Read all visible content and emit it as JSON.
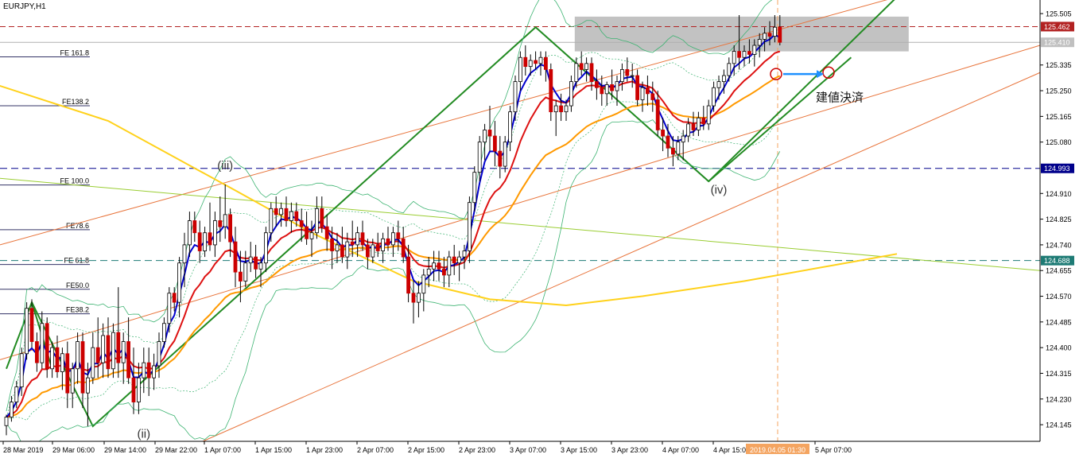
{
  "chart_data": {
    "type": "candlestick",
    "symbol_label": "EURJPY,H1",
    "price_axis": {
      "ticks": [
        "125.505",
        "125.335",
        "125.250",
        "125.165",
        "125.080",
        "124.910",
        "124.825",
        "124.740",
        "124.655",
        "124.570",
        "124.485",
        "124.400",
        "124.315",
        "124.230",
        "124.145"
      ],
      "range": [
        124.09,
        125.55
      ],
      "current_bid": "125.410",
      "markers": [
        {
          "label": "125.462",
          "value": 125.462,
          "color": "#b22222"
        },
        {
          "label": "124.993",
          "value": 124.993,
          "color": "#00008b"
        },
        {
          "label": "124.688",
          "value": 124.688,
          "color": "#1e7b75"
        }
      ]
    },
    "time_axis": {
      "labels": [
        "28 Mar 2019",
        "29 Mar 06:00",
        "29 Mar 14:00",
        "29 Mar 22:00",
        "1 Apr 07:00",
        "1 Apr 15:00",
        "1 Apr 23:00",
        "2 Apr 07:00",
        "2 Apr 15:00",
        "2 Apr 23:00",
        "3 Apr 07:00",
        "3 Apr 15:00",
        "3 Apr 23:00",
        "4 Apr 07:00",
        "4 Apr 15:00",
        "5 Apr 07:00"
      ],
      "cursor_label": "2019.04.05 01:30"
    },
    "fibonacci_levels": [
      {
        "label": "FE 161.8",
        "value": 125.362
      },
      {
        "label": "FE138.2",
        "value": 125.2
      },
      {
        "label": "FE 100.0",
        "value": 124.938
      },
      {
        "label": "FE78.6",
        "value": 124.79
      },
      {
        "label": "FE 61.8",
        "value": 124.675
      },
      {
        "label": "FE50.0",
        "value": 124.593
      },
      {
        "label": "FE38.2",
        "value": 124.512
      }
    ],
    "wave_labels": [
      {
        "label": "(iii)",
        "i": 43,
        "price": 124.99
      },
      {
        "label": "(ii)",
        "i": 27,
        "price": 124.102
      },
      {
        "label": "(iv)",
        "i": 140,
        "price": 124.91
      }
    ],
    "annotations": [
      {
        "label": "建値決済",
        "i": 162,
        "price": 125.215
      }
    ],
    "resistance_zone": {
      "high": 125.495,
      "low": 125.38
    },
    "candles_ohlc": [
      [
        124.142,
        124.178,
        124.11,
        124.17
      ],
      [
        124.17,
        124.24,
        124.155,
        124.22
      ],
      [
        124.22,
        124.29,
        124.2,
        124.27
      ],
      [
        124.27,
        124.4,
        124.24,
        124.38
      ],
      [
        124.38,
        124.55,
        124.36,
        124.53
      ],
      [
        124.53,
        124.56,
        124.4,
        124.42
      ],
      [
        124.42,
        124.45,
        124.32,
        124.35
      ],
      [
        124.35,
        124.52,
        124.33,
        124.48
      ],
      [
        124.48,
        124.5,
        124.3,
        124.33
      ],
      [
        124.33,
        124.42,
        124.3,
        124.4
      ],
      [
        124.4,
        124.44,
        124.3,
        124.32
      ],
      [
        124.32,
        124.4,
        124.26,
        124.38
      ],
      [
        124.38,
        124.42,
        124.2,
        124.25
      ],
      [
        124.25,
        124.35,
        124.2,
        124.33
      ],
      [
        124.33,
        124.45,
        124.28,
        124.42
      ],
      [
        124.42,
        124.45,
        124.2,
        124.25
      ],
      [
        124.25,
        124.35,
        124.14,
        124.3
      ],
      [
        124.3,
        124.45,
        124.28,
        124.4
      ],
      [
        124.4,
        124.5,
        124.3,
        124.35
      ],
      [
        124.35,
        124.48,
        124.3,
        124.44
      ],
      [
        124.44,
        124.5,
        124.3,
        124.33
      ],
      [
        124.33,
        124.48,
        124.3,
        124.45
      ],
      [
        124.45,
        124.6,
        124.3,
        124.35
      ],
      [
        124.35,
        124.45,
        124.28,
        124.42
      ],
      [
        124.42,
        124.5,
        124.28,
        124.3
      ],
      [
        124.3,
        124.4,
        124.18,
        124.22
      ],
      [
        124.22,
        124.35,
        124.18,
        124.3
      ],
      [
        124.3,
        124.4,
        124.25,
        124.35
      ],
      [
        124.35,
        124.4,
        124.24,
        124.3
      ],
      [
        124.3,
        124.38,
        124.26,
        124.34
      ],
      [
        124.34,
        124.45,
        124.3,
        124.42
      ],
      [
        124.42,
        124.5,
        124.4,
        124.48
      ],
      [
        124.48,
        124.6,
        124.45,
        124.58
      ],
      [
        124.58,
        124.6,
        124.52,
        124.55
      ],
      [
        124.55,
        124.7,
        124.5,
        124.68
      ],
      [
        124.68,
        124.78,
        124.6,
        124.74
      ],
      [
        124.74,
        124.85,
        124.7,
        124.82
      ],
      [
        124.82,
        124.85,
        124.75,
        124.78
      ],
      [
        124.78,
        124.82,
        124.68,
        124.72
      ],
      [
        124.72,
        124.8,
        124.7,
        124.78
      ],
      [
        124.78,
        124.88,
        124.72,
        124.74
      ],
      [
        124.74,
        124.85,
        124.7,
        124.82
      ],
      [
        124.82,
        124.9,
        124.75,
        124.8
      ],
      [
        124.8,
        124.94,
        124.76,
        124.84
      ],
      [
        124.84,
        124.86,
        124.7,
        124.75
      ],
      [
        124.75,
        124.8,
        124.6,
        124.65
      ],
      [
        124.65,
        124.72,
        124.55,
        124.62
      ],
      [
        124.62,
        124.72,
        124.6,
        124.68
      ],
      [
        124.68,
        124.75,
        124.65,
        124.7
      ],
      [
        124.7,
        124.74,
        124.63,
        124.66
      ],
      [
        124.66,
        124.7,
        124.6,
        124.68
      ],
      [
        124.68,
        124.8,
        124.65,
        124.78
      ],
      [
        124.78,
        124.88,
        124.75,
        124.86
      ],
      [
        124.86,
        124.9,
        124.8,
        124.84
      ],
      [
        124.84,
        124.88,
        124.8,
        124.86
      ],
      [
        124.86,
        124.9,
        124.8,
        124.82
      ],
      [
        124.82,
        124.88,
        124.78,
        124.85
      ],
      [
        124.85,
        124.88,
        124.8,
        124.82
      ],
      [
        124.82,
        124.86,
        124.75,
        124.8
      ],
      [
        124.8,
        124.85,
        124.74,
        124.76
      ],
      [
        124.76,
        124.82,
        124.7,
        124.78
      ],
      [
        124.78,
        124.9,
        124.76,
        124.86
      ],
      [
        124.86,
        124.9,
        124.78,
        124.8
      ],
      [
        124.8,
        124.84,
        124.72,
        124.76
      ],
      [
        124.76,
        124.8,
        124.66,
        124.72
      ],
      [
        124.72,
        124.78,
        124.68,
        124.74
      ],
      [
        124.74,
        124.8,
        124.68,
        124.7
      ],
      [
        124.7,
        124.78,
        124.66,
        124.75
      ],
      [
        124.75,
        124.82,
        124.7,
        124.74
      ],
      [
        124.74,
        124.8,
        124.7,
        124.78
      ],
      [
        124.78,
        124.82,
        124.72,
        124.74
      ],
      [
        124.74,
        124.76,
        124.66,
        124.7
      ],
      [
        124.7,
        124.76,
        124.68,
        124.74
      ],
      [
        124.74,
        124.78,
        124.7,
        124.72
      ],
      [
        124.72,
        124.78,
        124.68,
        124.76
      ],
      [
        124.76,
        124.8,
        124.72,
        124.74
      ],
      [
        124.74,
        124.8,
        124.7,
        124.78
      ],
      [
        124.78,
        124.82,
        124.72,
        124.76
      ],
      [
        124.76,
        124.8,
        124.68,
        124.7
      ],
      [
        124.7,
        124.74,
        124.55,
        124.58
      ],
      [
        124.58,
        124.62,
        124.48,
        124.55
      ],
      [
        124.55,
        124.62,
        124.5,
        124.58
      ],
      [
        124.58,
        124.66,
        124.52,
        124.64
      ],
      [
        124.64,
        124.7,
        124.6,
        124.66
      ],
      [
        124.66,
        124.72,
        124.62,
        124.68
      ],
      [
        124.68,
        124.72,
        124.62,
        124.66
      ],
      [
        124.66,
        124.7,
        124.6,
        124.64
      ],
      [
        124.64,
        124.72,
        124.6,
        124.7
      ],
      [
        124.7,
        124.74,
        124.64,
        124.68
      ],
      [
        124.68,
        124.72,
        124.62,
        124.7
      ],
      [
        124.7,
        124.74,
        124.66,
        124.72
      ],
      [
        124.72,
        124.9,
        124.68,
        124.88
      ],
      [
        124.88,
        125.0,
        124.85,
        124.98
      ],
      [
        124.98,
        125.1,
        124.95,
        125.08
      ],
      [
        125.08,
        125.14,
        125.02,
        125.12
      ],
      [
        125.12,
        125.2,
        125.05,
        125.1
      ],
      [
        125.1,
        125.15,
        125.0,
        125.05
      ],
      [
        125.05,
        125.1,
        124.96,
        125.0
      ],
      [
        125.0,
        125.1,
        124.98,
        125.08
      ],
      [
        125.08,
        125.2,
        125.05,
        125.18
      ],
      [
        125.18,
        125.3,
        125.15,
        125.28
      ],
      [
        125.28,
        125.38,
        125.25,
        125.36
      ],
      [
        125.36,
        125.4,
        125.3,
        125.33
      ],
      [
        125.33,
        125.37,
        125.3,
        125.35
      ],
      [
        125.35,
        125.38,
        125.32,
        125.34
      ],
      [
        125.34,
        125.38,
        125.3,
        125.36
      ],
      [
        125.36,
        125.38,
        125.28,
        125.32
      ],
      [
        125.32,
        125.34,
        125.15,
        125.18
      ],
      [
        125.18,
        125.22,
        125.1,
        125.2
      ],
      [
        125.2,
        125.24,
        125.15,
        125.18
      ],
      [
        125.18,
        125.22,
        125.15,
        125.2
      ],
      [
        125.2,
        125.3,
        125.18,
        125.28
      ],
      [
        125.28,
        125.36,
        125.26,
        125.34
      ],
      [
        125.34,
        125.38,
        125.3,
        125.32
      ],
      [
        125.32,
        125.36,
        125.28,
        125.34
      ],
      [
        125.34,
        125.36,
        125.25,
        125.28
      ],
      [
        125.28,
        125.32,
        125.22,
        125.26
      ],
      [
        125.26,
        125.3,
        125.2,
        125.24
      ],
      [
        125.24,
        125.28,
        125.2,
        125.27
      ],
      [
        125.27,
        125.32,
        125.22,
        125.25
      ],
      [
        125.25,
        125.3,
        125.2,
        125.28
      ],
      [
        125.28,
        125.34,
        125.25,
        125.32
      ],
      [
        125.32,
        125.36,
        125.28,
        125.3
      ],
      [
        125.3,
        125.34,
        125.26,
        125.3
      ],
      [
        125.3,
        125.32,
        125.2,
        125.22
      ],
      [
        125.22,
        125.28,
        125.18,
        125.26
      ],
      [
        125.26,
        125.3,
        125.2,
        125.24
      ],
      [
        125.24,
        125.28,
        125.18,
        125.22
      ],
      [
        125.22,
        125.25,
        125.1,
        125.12
      ],
      [
        125.12,
        125.16,
        125.05,
        125.1
      ],
      [
        125.1,
        125.14,
        125.03,
        125.06
      ],
      [
        125.06,
        125.1,
        125.0,
        125.04
      ],
      [
        125.04,
        125.1,
        125.02,
        125.08
      ],
      [
        125.08,
        125.12,
        125.02,
        125.1
      ],
      [
        125.1,
        125.16,
        125.08,
        125.14
      ],
      [
        125.14,
        125.18,
        125.1,
        125.12
      ],
      [
        125.12,
        125.18,
        125.1,
        125.16
      ],
      [
        125.16,
        125.2,
        125.12,
        125.14
      ],
      [
        125.14,
        125.22,
        125.12,
        125.2
      ],
      [
        125.2,
        125.28,
        125.18,
        125.26
      ],
      [
        125.26,
        125.3,
        125.22,
        125.28
      ],
      [
        125.28,
        125.32,
        125.24,
        125.3
      ],
      [
        125.3,
        125.36,
        125.28,
        125.34
      ],
      [
        125.34,
        125.4,
        125.3,
        125.38
      ],
      [
        125.38,
        125.5,
        125.32,
        125.36
      ],
      [
        125.36,
        125.4,
        125.33,
        125.38
      ],
      [
        125.38,
        125.42,
        125.34,
        125.37
      ],
      [
        125.37,
        125.42,
        125.33,
        125.4
      ],
      [
        125.4,
        125.44,
        125.36,
        125.42
      ],
      [
        125.42,
        125.46,
        125.38,
        125.44
      ],
      [
        125.44,
        125.48,
        125.4,
        125.43
      ],
      [
        125.43,
        125.5,
        125.41,
        125.46
      ],
      [
        125.46,
        125.5,
        125.4,
        125.41
      ]
    ],
    "moving_averages": [
      {
        "name": "ema_fast",
        "color": "#0000cd",
        "period": 4
      },
      {
        "name": "ema_mid",
        "color": "#dd1111",
        "period": 12
      },
      {
        "name": "ema_slow",
        "color": "#ff9900",
        "period": 30
      }
    ],
    "long_ma_yellow": [
      [
        -2,
        125.27
      ],
      [
        20,
        125.15
      ],
      [
        45,
        124.92
      ],
      [
        60,
        124.78
      ],
      [
        80,
        124.62
      ],
      [
        95,
        124.56
      ],
      [
        110,
        124.54
      ],
      [
        125,
        124.57
      ],
      [
        145,
        124.62
      ],
      [
        165,
        124.68
      ],
      [
        175,
        124.71
      ]
    ],
    "grid": false
  }
}
